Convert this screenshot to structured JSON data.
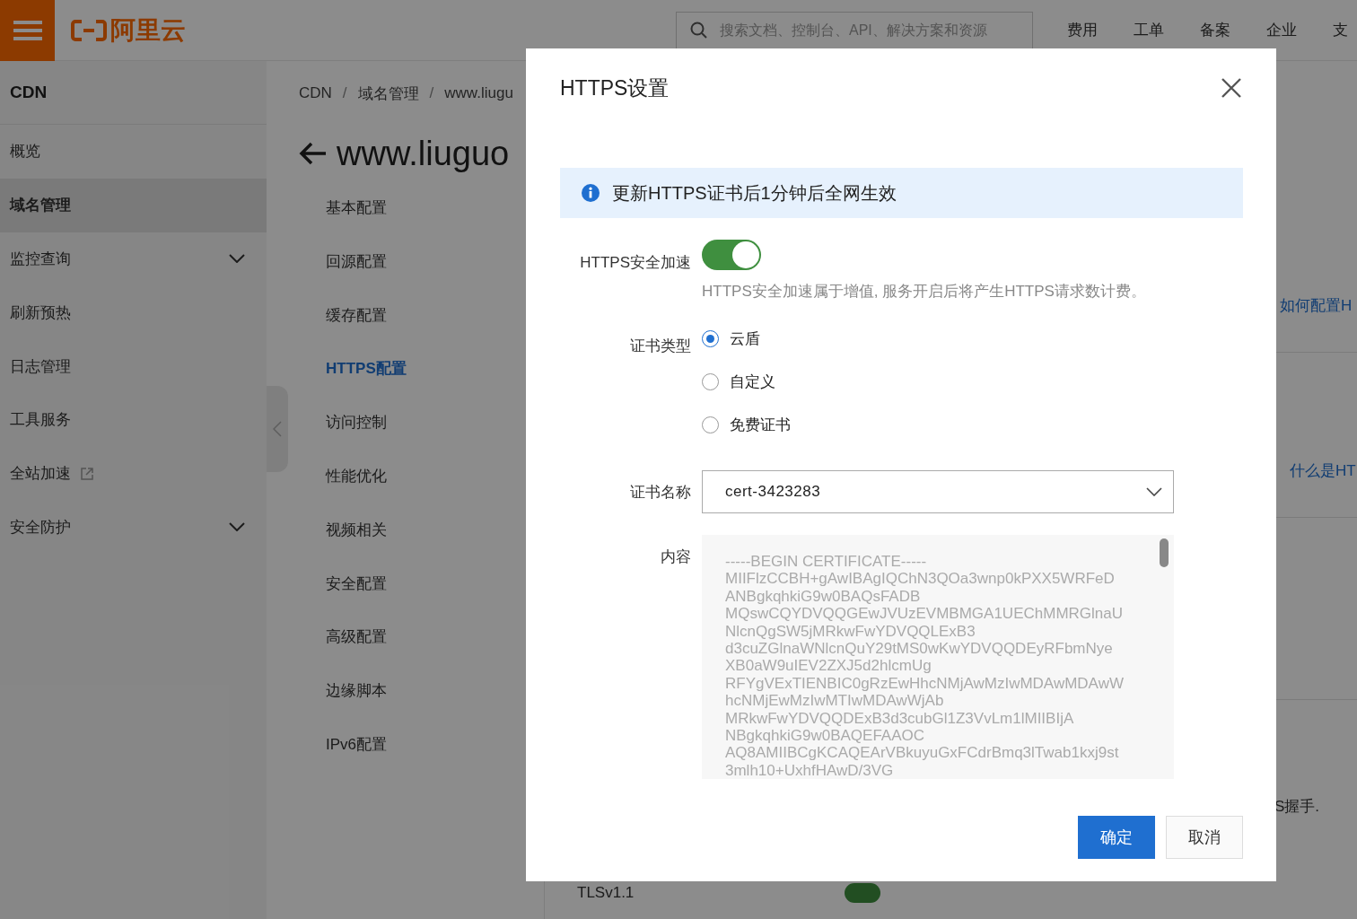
{
  "topbar": {
    "logo": "阿里云",
    "search": {
      "placeholder": "搜索文档、控制台、API、解决方案和资源"
    },
    "nav": [
      "费用",
      "工单",
      "备案",
      "企业",
      "支"
    ]
  },
  "sidebar": {
    "title": "CDN",
    "items": [
      {
        "label": "概览",
        "selected": false,
        "expandable": false,
        "external": false
      },
      {
        "label": "域名管理",
        "selected": true,
        "expandable": false,
        "external": false
      },
      {
        "label": "监控查询",
        "selected": false,
        "expandable": true,
        "external": false
      },
      {
        "label": "刷新预热",
        "selected": false,
        "expandable": false,
        "external": false
      },
      {
        "label": "日志管理",
        "selected": false,
        "expandable": false,
        "external": false
      },
      {
        "label": "工具服务",
        "selected": false,
        "expandable": false,
        "external": false
      },
      {
        "label": "全站加速",
        "selected": false,
        "expandable": false,
        "external": true
      },
      {
        "label": "安全防护",
        "selected": false,
        "expandable": true,
        "external": false
      }
    ]
  },
  "breadcrumb": [
    {
      "text": "CDN",
      "kind": "link"
    },
    {
      "text": "/",
      "kind": "separator"
    },
    {
      "text": "域名管理",
      "kind": "link"
    },
    {
      "text": "/",
      "kind": "separator"
    },
    {
      "text": "www.liugu",
      "kind": "link"
    }
  ],
  "page_title": "www.liuguo",
  "subnav": [
    {
      "label": "基本配置",
      "selected": false
    },
    {
      "label": "回源配置",
      "selected": false
    },
    {
      "label": "缓存配置",
      "selected": false
    },
    {
      "label": "HTTPS配置",
      "selected": true
    },
    {
      "label": "访问控制",
      "selected": false
    },
    {
      "label": "性能优化",
      "selected": false
    },
    {
      "label": "视频相关",
      "selected": false
    },
    {
      "label": "安全配置",
      "selected": false
    },
    {
      "label": "高级配置",
      "selected": false
    },
    {
      "label": "边缘脚本",
      "selected": false
    },
    {
      "label": "IPv6配置",
      "selected": false
    }
  ],
  "help_panel": {
    "links": [
      "如何配置H",
      "什么是HT"
    ],
    "text": "S握手.",
    "setting": {
      "label": "TLSv1.1",
      "on": true
    }
  },
  "dialog": {
    "title": "HTTPS设置",
    "alert": "更新HTTPS证书后1分钟后全网生效",
    "acceleration": {
      "label": "HTTPS安全加速",
      "on": true,
      "hint": "HTTPS安全加速属于增值, 服务开启后将产生HTTPS请求数计费。"
    },
    "cert_type": {
      "label": "证书类型",
      "options": [
        {
          "label": "云盾",
          "selected": true
        },
        {
          "label": "自定义",
          "selected": false
        },
        {
          "label": "免费证书",
          "selected": false
        }
      ]
    },
    "cert_name": {
      "label": "证书名称",
      "value": "cert-3423283"
    },
    "content": {
      "label": "内容",
      "lines": [
        "-----BEGIN CERTIFICATE-----",
        "MIIFlzCCBH+gAwIBAgIQChN3QOa3wnp0kPXX5WRFeD",
        "ANBgkqhkiG9w0BAQsFADB",
        "MQswCQYDVQQGEwJVUzEVMBMGA1UEChMMRGlnaU",
        "NlcnQgSW5jMRkwFwYDVQQLExB3",
        "d3cuZGlnaWNlcnQuY29tMS0wKwYDVQQDEyRFbmNye",
        "XB0aW9uIEV2ZXJ5d2hlcmUg",
        "RFYgVExTIENBIC0gRzEwHhcNMjAwMzIwMDAwMDAwW",
        "hcNMjEwMzIwMTIwMDAwWjAb",
        "MRkwFwYDVQQDExB3d3cubGl1Z3VvLm1lMIIBIjA",
        "NBgkqhkiG9w0BAQEFAAOC",
        "AQ8AMIIBCgKCAQEArVBkuyuGxFCdrBmq3lTwab1kxj9st",
        "3mlh10+UxhfHAwD/3VG"
      ]
    },
    "buttons": [
      {
        "label": "确定",
        "kind": "primary"
      },
      {
        "label": "取消",
        "kind": "secondary"
      }
    ]
  }
}
